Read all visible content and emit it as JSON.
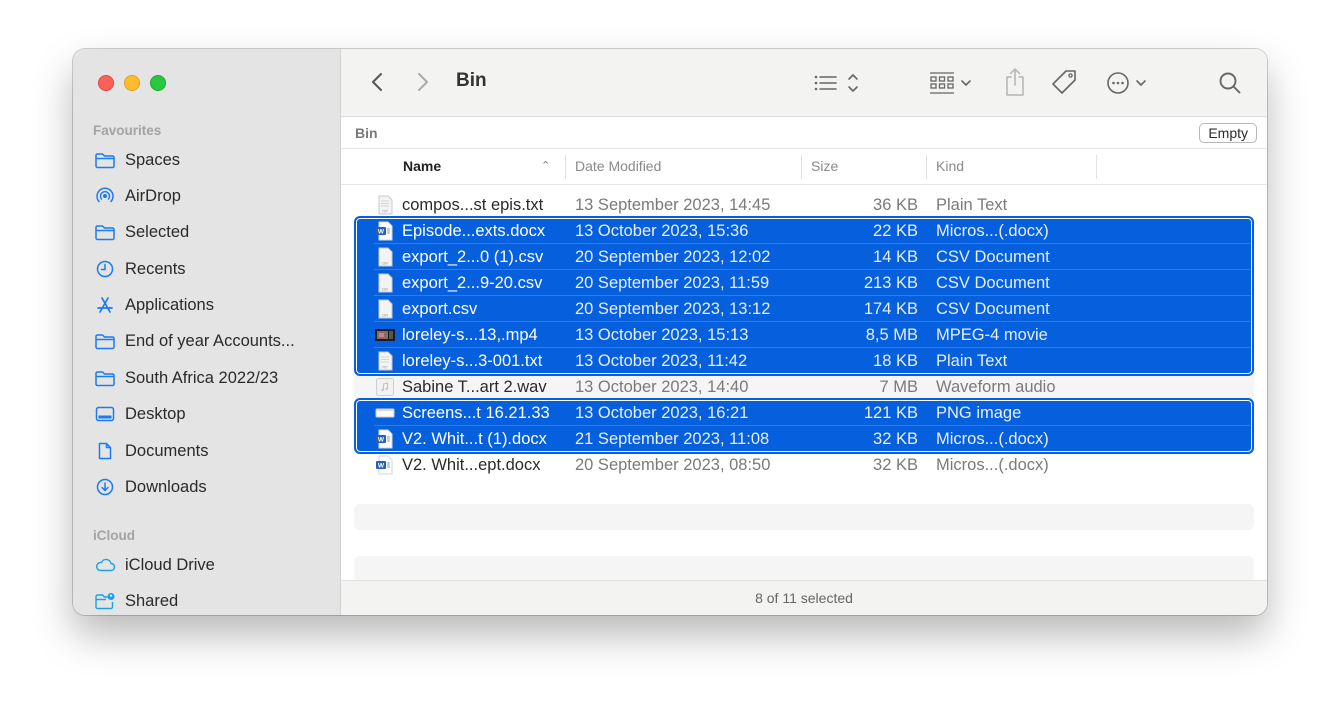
{
  "window": {
    "title": "Bin"
  },
  "sidebar": {
    "sections": [
      {
        "label": "Favourites",
        "items": [
          {
            "label": "Spaces",
            "icon": "folder-icon"
          },
          {
            "label": "AirDrop",
            "icon": "airdrop-icon"
          },
          {
            "label": "Selected",
            "icon": "folder-icon"
          },
          {
            "label": "Recents",
            "icon": "clock-icon"
          },
          {
            "label": "Applications",
            "icon": "applications-icon"
          },
          {
            "label": "End of year Accounts...",
            "icon": "folder-icon"
          },
          {
            "label": "South Africa 2022/23",
            "icon": "folder-icon"
          },
          {
            "label": "Desktop",
            "icon": "desktop-icon"
          },
          {
            "label": "Documents",
            "icon": "document-icon"
          },
          {
            "label": "Downloads",
            "icon": "download-icon"
          }
        ]
      },
      {
        "label": "iCloud",
        "items": [
          {
            "label": "iCloud Drive",
            "icon": "cloud-icon"
          },
          {
            "label": "Shared",
            "icon": "shared-folder-icon"
          }
        ]
      }
    ]
  },
  "toolbar": {
    "back": "chevron-left-icon",
    "forward": "chevron-right-icon",
    "title": "Bin",
    "view_mode": "list-view-icon",
    "group": "grid-group-icon",
    "share": "share-icon",
    "tag": "tag-icon",
    "more": "more-icon",
    "search": "search-icon"
  },
  "pathbar": {
    "location": "Bin",
    "empty_label": "Empty"
  },
  "columns": {
    "name": "Name",
    "date": "Date Modified",
    "size": "Size",
    "kind": "Kind"
  },
  "files": [
    {
      "name": "compos...st epis.txt",
      "date": "13 September 2023, 14:45",
      "size": "36 KB",
      "kind": "Plain Text",
      "icon": "text-file-icon",
      "selected": false
    },
    {
      "name": "Episode...exts.docx",
      "date": "13 October 2023, 15:36",
      "size": "22 KB",
      "kind": "Micros...(.docx)",
      "icon": "word-file-icon",
      "selected": true
    },
    {
      "name": "export_2...0 (1).csv",
      "date": "20 September 2023, 12:02",
      "size": "14 KB",
      "kind": "CSV Document",
      "icon": "csv-file-icon",
      "selected": true
    },
    {
      "name": "export_2...9-20.csv",
      "date": "20 September 2023, 11:59",
      "size": "213 KB",
      "kind": "CSV Document",
      "icon": "csv-file-icon",
      "selected": true
    },
    {
      "name": "export.csv",
      "date": "20 September 2023, 13:12",
      "size": "174 KB",
      "kind": "CSV Document",
      "icon": "csv-file-icon",
      "selected": true
    },
    {
      "name": "loreley-s...13,.mp4",
      "date": "13 October 2023, 15:13",
      "size": "8,5 MB",
      "kind": "MPEG-4 movie",
      "icon": "video-file-icon",
      "selected": true
    },
    {
      "name": "loreley-s...3-001.txt",
      "date": "13 October 2023, 11:42",
      "size": "18 KB",
      "kind": "Plain Text",
      "icon": "text-file-icon",
      "selected": true
    },
    {
      "name": "Sabine T...art 2.wav",
      "date": "13 October 2023, 14:40",
      "size": "7 MB",
      "kind": "Waveform audio",
      "icon": "audio-file-icon",
      "selected": false
    },
    {
      "name": "Screens...t 16.21.33",
      "date": "13 October 2023, 16:21",
      "size": "121 KB",
      "kind": "PNG image",
      "icon": "image-file-icon",
      "selected": true
    },
    {
      "name": "V2. Whit...t (1).docx",
      "date": "21 September 2023, 11:08",
      "size": "32 KB",
      "kind": "Micros...(.docx)",
      "icon": "word-file-icon",
      "selected": true
    },
    {
      "name": "V2. Whit...ept.docx",
      "date": "20 September 2023, 08:50",
      "size": "32 KB",
      "kind": "Micros...(.docx)",
      "icon": "word-file-icon",
      "selected": false
    }
  ],
  "status": {
    "text": "8 of 11 selected"
  },
  "colors": {
    "selection": "#0660de",
    "accent": "#1a7bf2"
  }
}
